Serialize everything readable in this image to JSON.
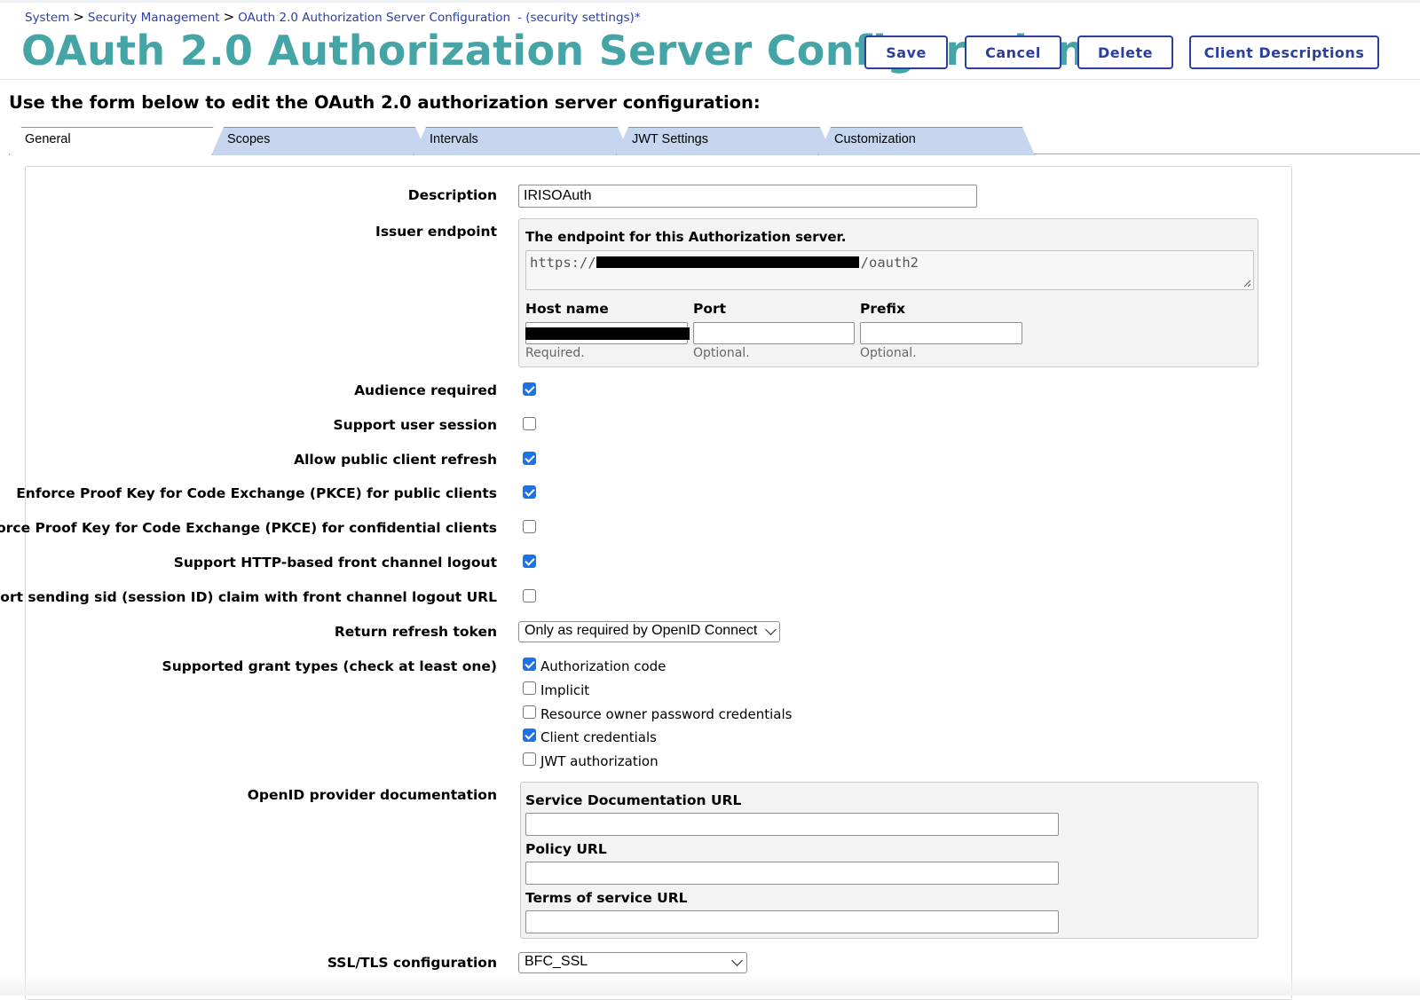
{
  "breadcrumb": {
    "items": [
      "System",
      "Security Management",
      "OAuth 2.0 Authorization Server Configuration"
    ],
    "separator": ">",
    "suffix": "- (security settings)*"
  },
  "page": {
    "title": "OAuth 2.0 Authorization Server Configuration",
    "instructions": "Use the form below to edit the OAuth 2.0 authorization server configuration:"
  },
  "toolbar": {
    "save_label": "Save",
    "cancel_label": "Cancel",
    "delete_label": "Delete",
    "client_descriptions_label": "Client Descriptions"
  },
  "tabs": [
    {
      "label": "General",
      "active": true
    },
    {
      "label": "Scopes",
      "active": false
    },
    {
      "label": "Intervals",
      "active": false
    },
    {
      "label": "JWT Settings",
      "active": false
    },
    {
      "label": "Customization",
      "active": false
    }
  ],
  "form": {
    "description": {
      "label": "Description",
      "value": "IRISOAuth"
    },
    "issuer": {
      "label": "Issuer endpoint",
      "caption": "The endpoint for this Authorization server.",
      "url_prefix": "https://",
      "url_suffix": "/oauth2",
      "host_label": "Host name",
      "port_label": "Port",
      "prefix_label": "Prefix",
      "host_hint": "Required.",
      "port_hint": "Optional.",
      "prefix_hint": "Optional.",
      "port_value": "",
      "prefix_value": ""
    },
    "checkboxes": [
      {
        "label": "Audience required",
        "checked": true
      },
      {
        "label": "Support user session",
        "checked": false
      },
      {
        "label": "Allow public client refresh",
        "checked": true
      },
      {
        "label": "Enforce Proof Key for Code Exchange (PKCE) for public clients",
        "checked": true
      },
      {
        "label": "Enforce Proof Key for Code Exchange (PKCE) for confidential clients",
        "checked": false
      },
      {
        "label": "Support HTTP-based front channel logout",
        "checked": true
      },
      {
        "label": "Support sending sid (session ID) claim with front channel logout URL",
        "checked": false
      }
    ],
    "refresh_token": {
      "label": "Return refresh token",
      "value": "Only as required by OpenID Connect"
    },
    "grant_types": {
      "label": "Supported grant types (check at least one)",
      "options": [
        {
          "label": "Authorization code",
          "checked": true
        },
        {
          "label": "Implicit",
          "checked": false
        },
        {
          "label": "Resource owner password credentials",
          "checked": false
        },
        {
          "label": "Client credentials",
          "checked": true
        },
        {
          "label": "JWT authorization",
          "checked": false
        }
      ]
    },
    "openid_docs": {
      "label": "OpenID provider documentation",
      "service_doc_label": "Service Documentation URL",
      "policy_label": "Policy URL",
      "tos_label": "Terms of service URL",
      "service_doc_value": "",
      "policy_value": "",
      "tos_value": ""
    },
    "ssl": {
      "label": "SSL/TLS configuration",
      "value": "BFC_SSL"
    }
  },
  "colors": {
    "title": "#45a5a6",
    "link": "#2b3f9e",
    "tab_inactive": "#c5d6ee",
    "checkbox_checked": "#1a73e8",
    "group_background": "#f3f3f3"
  },
  "icons": [
    "chevron-down-icon",
    "resize-grip-icon",
    "checkmark-icon"
  ]
}
